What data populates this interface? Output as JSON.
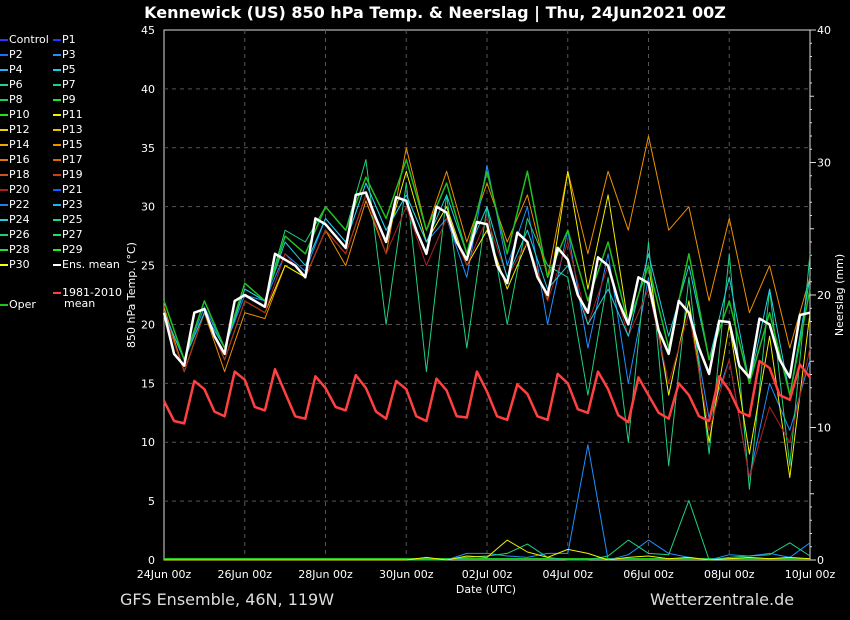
{
  "title": "Kennewick  (US)  850 hPa Temp. & Neerslag | Thu, 24Jun2021 00Z",
  "footer": {
    "left": "GFS Ensemble, 46N, 119W",
    "right": "Wetterzentrale.de"
  },
  "legend": [
    {
      "name": "Control",
      "color": "#3030ff"
    },
    {
      "name": "P1",
      "color": "#1a3cff"
    },
    {
      "name": "P2",
      "color": "#1e6cff"
    },
    {
      "name": "P3",
      "color": "#1e90ff"
    },
    {
      "name": "P4",
      "color": "#22b4ee"
    },
    {
      "name": "P5",
      "color": "#22c8dd"
    },
    {
      "name": "P6",
      "color": "#20d0a0"
    },
    {
      "name": "P7",
      "color": "#20d080"
    },
    {
      "name": "P8",
      "color": "#20d050"
    },
    {
      "name": "P9",
      "color": "#20e030"
    },
    {
      "name": "P10",
      "color": "#20e020"
    },
    {
      "name": "P11",
      "color": "#f0f000"
    },
    {
      "name": "P12",
      "color": "#f0d000"
    },
    {
      "name": "P13",
      "color": "#f0c000"
    },
    {
      "name": "P14",
      "color": "#f0a800"
    },
    {
      "name": "P15",
      "color": "#f09000"
    },
    {
      "name": "P16",
      "color": "#e07800"
    },
    {
      "name": "P17",
      "color": "#e06800"
    },
    {
      "name": "P18",
      "color": "#d05020"
    },
    {
      "name": "P19",
      "color": "#c84020"
    },
    {
      "name": "P20",
      "color": "#b02020"
    },
    {
      "name": "P21",
      "color": "#1060ff"
    },
    {
      "name": "P22",
      "color": "#1e80f0"
    },
    {
      "name": "P23",
      "color": "#20b0f0"
    },
    {
      "name": "P24",
      "color": "#20d0e0"
    },
    {
      "name": "P25",
      "color": "#20d0a0"
    },
    {
      "name": "P26",
      "color": "#20d070"
    },
    {
      "name": "P27",
      "color": "#20e060"
    },
    {
      "name": "P28",
      "color": "#20e030"
    },
    {
      "name": "P29",
      "color": "#20f020"
    },
    {
      "name": "P30",
      "color": "#ffff00"
    },
    {
      "name": "Ens. mean",
      "color": "#ffffff"
    }
  ],
  "legend_clim": {
    "name1": "1981-2010",
    "name2": "mean",
    "color": "#ff4040"
  },
  "legend_oper": {
    "name": "Oper",
    "color": "#20c020"
  },
  "chart_data": {
    "type": "line",
    "title": "Kennewick  (US)  850 hPa Temp. & Neerslag | Thu, 24Jun2021 00Z",
    "xlabel": "Date (UTC)",
    "ylabel": "850 hPa Temp. (°C)",
    "y2label": "Neerslag (mm)",
    "ylim": [
      0,
      45
    ],
    "y2lim": [
      0,
      40
    ],
    "yticks": [
      0,
      5,
      10,
      15,
      20,
      25,
      30,
      35,
      40,
      45
    ],
    "y2ticks": [
      0,
      10,
      20,
      30,
      40
    ],
    "xticks": [
      "24Jun 00z",
      "26Jun 00z",
      "28Jun 00z",
      "30Jun 00z",
      "02Jul 00z",
      "04Jul 00z",
      "06Jul 00z",
      "08Jul 00z",
      "10Jul 00z"
    ],
    "x_start": "24Jun2021 00z",
    "x_end": "10Jul2021 00z",
    "grid": true,
    "ens_mean_6h": [
      21,
      17.5,
      16.5,
      21,
      21.3,
      19,
      17.5,
      22,
      22.5,
      22,
      21.5,
      26,
      25.5,
      25,
      24,
      29,
      28.5,
      27.5,
      26.5,
      31,
      31.2,
      29,
      27,
      30.8,
      30.5,
      28,
      26,
      30,
      29.5,
      27,
      25.5,
      28.7,
      28.5,
      25,
      23.5,
      27.8,
      27,
      24,
      22.5,
      26.5,
      25.5,
      22.5,
      21,
      25.7,
      25,
      22,
      20,
      24,
      23.5,
      19.5,
      17.5,
      22,
      21,
      18,
      15.8,
      20.3,
      20.2,
      16.5,
      15.5,
      20.5,
      20,
      17,
      15.5,
      20.8,
      21
    ],
    "climate_mean_6h": [
      13.5,
      11.8,
      11.6,
      15.2,
      14.5,
      12.6,
      12.2,
      16.0,
      15.3,
      13.0,
      12.7,
      16.2,
      14.2,
      12.2,
      12.0,
      15.6,
      14.6,
      13.0,
      12.7,
      15.7,
      14.6,
      12.6,
      12.0,
      15.2,
      14.5,
      12.2,
      11.8,
      15.4,
      14.4,
      12.2,
      12.1,
      16.0,
      14.3,
      12.2,
      11.9,
      14.9,
      14.1,
      12.2,
      11.9,
      15.8,
      15.0,
      12.8,
      12.5,
      16.0,
      14.5,
      12.3,
      11.7,
      15.5,
      14.0,
      12.5,
      12.0,
      15.0,
      14.0,
      12.2,
      11.8,
      15.6,
      14.4,
      12.6,
      12.2,
      16.9,
      16.3,
      14.0,
      13.6,
      16.6,
      15.5
    ],
    "members_12h": [
      {
        "name": "P15",
        "values": [
          21.5,
          16,
          21,
          16,
          21,
          20.5,
          25,
          24,
          28,
          25,
          30.5,
          26,
          35,
          28,
          33,
          27,
          32,
          27,
          31,
          24,
          33,
          26,
          33,
          28,
          36,
          28,
          30,
          22,
          29,
          21,
          25,
          18,
          24
        ]
      },
      {
        "name": "P3",
        "values": [
          21,
          17,
          21.5,
          18,
          22.5,
          22,
          26,
          24.5,
          29,
          27,
          32,
          28,
          31,
          27,
          29,
          24,
          33.5,
          25,
          30,
          20,
          28,
          18,
          26,
          15,
          24,
          14,
          22,
          12,
          17,
          7,
          15,
          11,
          17
        ]
      },
      {
        "name": "P7",
        "values": [
          22,
          17,
          22,
          18,
          23,
          22,
          28,
          27,
          30,
          28,
          34,
          20,
          32,
          16,
          31,
          18,
          30,
          20,
          29,
          25,
          24,
          14,
          24,
          10,
          27,
          8,
          24,
          9,
          26,
          6,
          23,
          8,
          26
        ]
      },
      {
        "name": "P11",
        "values": [
          21,
          16,
          21,
          17,
          22,
          21,
          25,
          24,
          28,
          26,
          31,
          27,
          33,
          27,
          30,
          25,
          28,
          23,
          27,
          22,
          33,
          23,
          31,
          20,
          25,
          14,
          22,
          10,
          20,
          9,
          19,
          7,
          21
        ]
      },
      {
        "name": "P20",
        "values": [
          21,
          16,
          21,
          17,
          22,
          21,
          26,
          24,
          28,
          26,
          31,
          26,
          30,
          25,
          29,
          25,
          29,
          24,
          27,
          22,
          27,
          20,
          25,
          19,
          23,
          15,
          21,
          11,
          17,
          7,
          13,
          10,
          18
        ]
      },
      {
        "name": "P24",
        "values": [
          21,
          17,
          21,
          18,
          23,
          22,
          27,
          25,
          29,
          27,
          32,
          28,
          31,
          27,
          31,
          26,
          30,
          24,
          28,
          23,
          25,
          20,
          23,
          19,
          26,
          19,
          25,
          17,
          24,
          15,
          23,
          14,
          24
        ]
      },
      {
        "name": "Oper",
        "values": [
          22,
          17,
          22,
          18,
          23.5,
          22,
          27.5,
          26,
          30,
          28,
          32.5,
          29,
          34,
          28,
          32,
          26,
          33,
          26,
          33,
          24,
          28,
          22,
          27,
          20,
          25,
          18,
          26,
          17,
          22,
          15,
          21,
          14,
          23
        ]
      }
    ],
    "precip_12h": [
      {
        "name": "P3",
        "values": [
          0,
          0,
          0,
          0,
          0,
          0,
          0,
          0,
          0,
          0,
          0,
          0,
          0,
          0,
          0,
          0.5,
          0.5,
          0.3,
          0.2,
          0.5,
          0.5,
          8.7,
          0,
          0.4,
          1.5,
          0.5,
          0.2,
          0,
          0.4,
          0.3,
          0.5,
          0.2,
          1.3
        ]
      },
      {
        "name": "P7",
        "values": [
          0,
          0,
          0,
          0,
          0,
          0,
          0,
          0,
          0,
          0,
          0,
          0,
          0,
          0,
          0,
          0.2,
          0.3,
          0.5,
          1.2,
          0.2,
          0,
          0,
          0.3,
          1.5,
          0.5,
          0.4,
          4.5,
          0,
          0.2,
          0.3,
          0.4,
          1.3,
          0.3
        ]
      },
      {
        "name": "P11",
        "values": [
          0,
          0,
          0,
          0,
          0,
          0,
          0,
          0,
          0,
          0,
          0,
          0,
          0,
          0.2,
          0,
          0.3,
          0.2,
          1.5,
          0.6,
          0.2,
          0.8,
          0.5,
          0,
          0.2,
          0.3,
          0.1,
          0.2,
          0,
          0.1,
          0.2,
          0.1,
          0.2,
          0.1
        ]
      }
    ]
  }
}
